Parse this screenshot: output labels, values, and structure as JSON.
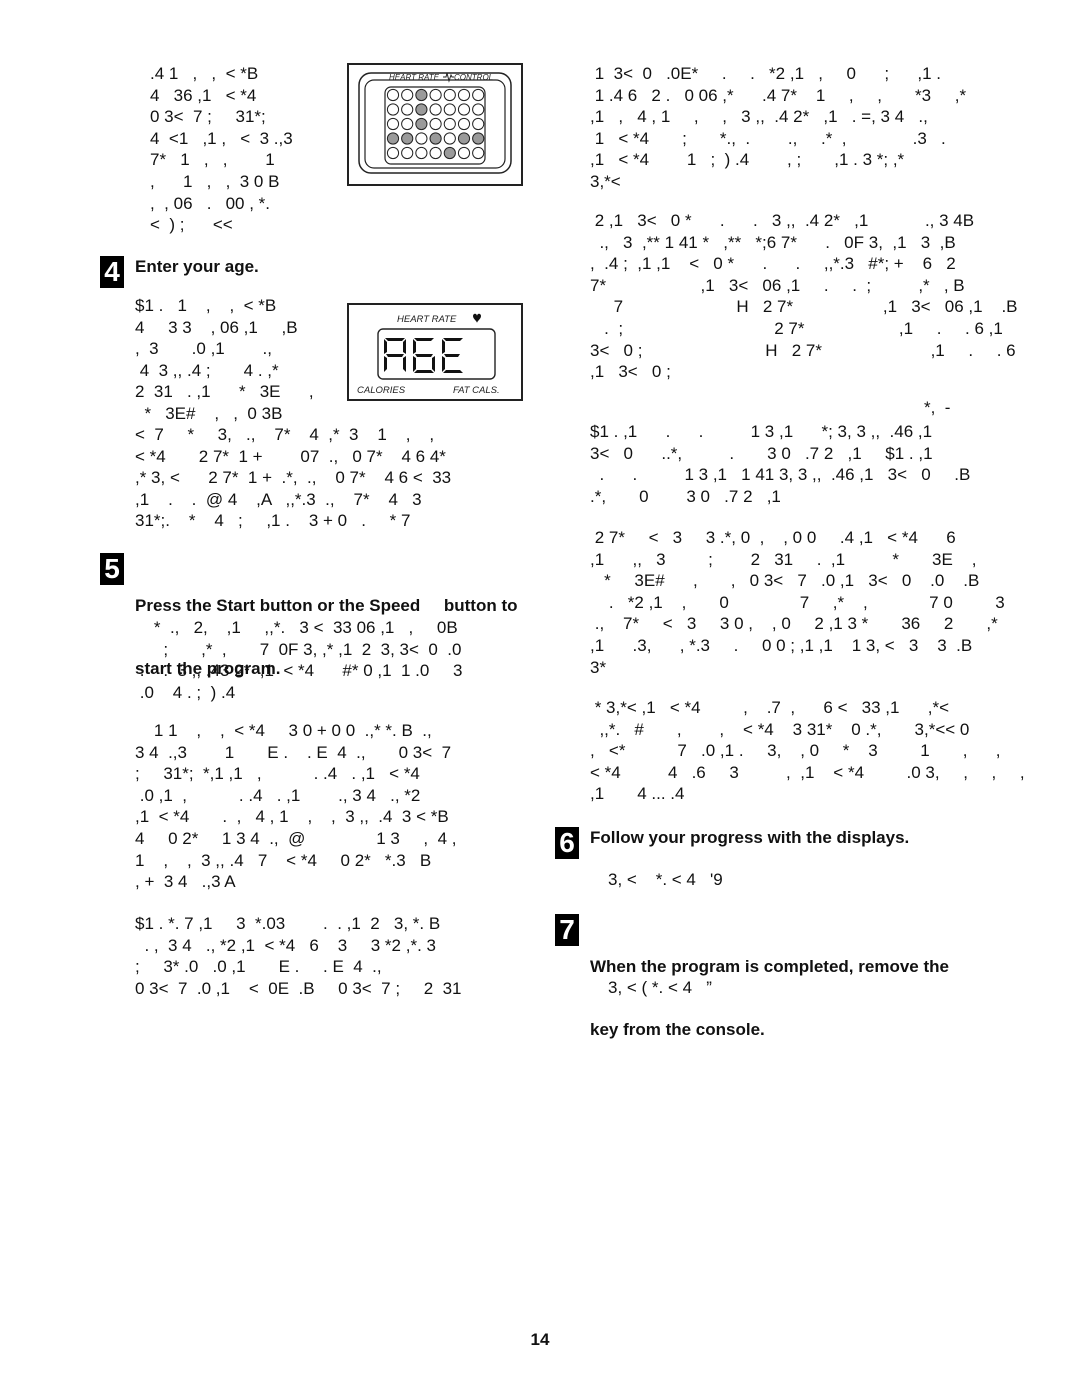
{
  "page": {
    "number": "14"
  },
  "left_column": {
    "intro_lines": [
      ".4 1   ,   ,  < *B",
      "4   36 ,1   < *4",
      "0 3<  7 ;     31*;",
      "4  <1   ,1 ,   <  3 .,3",
      "7*   1   ,   ,        1",
      ",      1   ,   ,  3 0 B",
      ",  , 06   .   00 , *.",
      "<  ) ;      <<"
    ],
    "step4": {
      "number": "4",
      "title": "Enter your age.",
      "lines_beside_figure": [
        "$1 .   1    ,    ,  < *B",
        "4     3 3    , 06 ,1     ,B",
        ",  3       .0 ,1        .,",
        " 4  3 ,, .4 ;       4 . ,*",
        "2  31   . ,1      *   3E      ,",
        "  *   3E#    ,   ,  0 3B"
      ],
      "lines_full": [
        "<  7     *     3,   .,    7*    4  ,*  3    1    ,    ,",
        "< *4       2 7*  1 +        07  .,   0 7*    4 6 4*",
        ",* 3, <      2 7*  1 +  .*,  .,    0 7*    4 6 <  33",
        ",1    .    .  @ 4    ,A   ,,*.3  .,    7*    4   3",
        "31*;.    *    4   ;     ,1 .    3 + 0   .     * 7"
      ]
    },
    "step5": {
      "number": "5",
      "title_lines": [
        "Press the Start button or the Speed     button to",
        "start the program."
      ],
      "para1": [
        "    *  .,   2,    ,1     ,,*.   3 <  33 06 ,1   ,     0B",
        "      ;       ,*  ,       7  0F 3, ,* ,1  2  3, 3<  0  .0",
        " .    .  3 ,, .43 2*  ,1  < *4      #* 0 ,1  1 .0     3",
        " .0    4 . ;  ) .4"
      ],
      "para2": [
        "    1 1    ,    ,  < *4     3 0 + 0 0  .,* *. B  .,",
        "3 4  .,3        1       E .    . E  4  .,       0 3<  7",
        ";     31*;  *,1 ,1   ,           . .4   . ,1   < *4",
        " .0 ,1  ,           . .4   . ,1        ., 3 4   ., *2",
        ",1  < *4       .  ,   4 , 1    ,    ,  3 ,,  .4  3 < *B",
        "4     0 2*     1 3 4  .,  @               1 3     ,  4 ,",
        "1    ,    ,  3 ,, .4   7    < *4     0 2*   *.3   B",
        ", +  3 4   .,3 A"
      ],
      "para3": [
        "$1 . *. 7 ,1     3  *.03        .  . ,1  2   3, *. B",
        "  . ,  3 4   ., *2 ,1  < *4   6    3     3 *2 ,*. 3",
        ";     3* .0   .0 ,1       E .     . E  4  .,",
        "0 3<  7  .0 ,1    <  0E  .B     0 3<  7 ;     2  31"
      ]
    }
  },
  "right_column": {
    "para1": [
      " 1  3<  0   .0E*     .     .   *2 ,1   ,     0      ;      ,1 .",
      " 1 .4 6   2 .   0 06 ,*      .4 7*    1     ,     ,       *3     ,*",
      ",1   ,   4 , 1     ,     ,   3 ,,  .4 2*   ,1   . =, 3 4   .,",
      " 1   < *4       ;       *.,  .        .,     .*  ,              .3   .",
      ",1   < *4        1   ;  ) .4        , ;       ,1 . 3 *; ,*",
      "3,*<"
    ],
    "para2": [
      " 2 ,1   3<   0 *      .      .   3 ,,  .4 2*   ,1            ., 3 4B",
      "  .,   3  ,** 1 41 *   ,**   *;6 7*      .   0F 3,  ,1   3  ,B",
      ",  .4 ;  ,1 ,1    <   0 *      .      .     ,,*.3   #*; +    6   2",
      "7*                    ,1   3<   06 ,1     .     .  ;          ,*   , B",
      "     7                        H   2 7*                   ,1   3<   06 ,1    .B",
      "   .  ;                                2 7*                    ,1     .     . 6 ,1",
      "3<   0 ;                          H   2 7*                       ,1     .     . 6",
      ",1   3<   0 ;"
    ],
    "para3_marker": "*,  -",
    "para3": [
      "$1 . ,1      .      .          1 3 ,1      *; 3, 3 ,,  .46 ,1",
      "3<   0      ..*,          .       3 0   .7 2   ,1     $1 . ,1",
      "  .      .          1 3 ,1   1 41 3, 3 ,,  .46 ,1   3<   0     .B",
      ".*,       0        3 0   .7 2   ,1"
    ],
    "para4": [
      " 2 7*     <   3     3 .*, 0  ,    , 0 0     .4 ,1   < *4      6",
      ",1      ,,   3         ;        2   31     .  ,1          *       3E    ,",
      "   *     3E#      ,       ,   0 3<   7   .0 ,1   3<   0    .0    .B",
      "    .   *2 ,1    ,       0               7     ,*    ,             7 0         3",
      " .,    7*     <   3     3 0 ,    , 0     2 ,1 3 *       36     2       ,*",
      ",1      .3,      , *.3     .     0 0 ; ,1 ,1    1 3, <   3    3  .B",
      "3*"
    ],
    "para5": [
      " * 3,*< ,1   < *4         ,    .7  ,      6 <   33 ,1      ,*<",
      "  ,,*.   #       ,        ,    < *4    3 31*    0 .*,       3,*<< 0",
      ",   <*           7   .0 ,1 .     3,    , 0     *    3         1       ,      ,",
      "< *4          4   .6     3          ,  ,1    < *4         .0 3,     ,     ,     ,",
      ",1       4 ... .4"
    ],
    "step6": {
      "number": "6",
      "title": "Follow your progress with the displays.",
      "body": "3, <    *. < 4   '9"
    },
    "step7": {
      "number": "7",
      "title_lines": [
        "When the program is completed, remove the",
        "key from the console."
      ],
      "body": "3, < ( *. < 4   ”"
    }
  },
  "figures": {
    "heart_rate_control": {
      "label": "HEART RATE",
      "label2": "CONTROL",
      "grid_rows": 5,
      "grid_cols": 7,
      "lit_cells": [
        [
          0,
          2
        ],
        [
          1,
          2
        ],
        [
          2,
          2
        ],
        [
          3,
          0
        ],
        [
          3,
          1
        ],
        [
          3,
          3
        ],
        [
          3,
          5
        ],
        [
          3,
          6
        ],
        [
          4,
          4
        ]
      ],
      "lit_color": "#9a9a9a"
    },
    "age_display": {
      "top_label": "HEART RATE",
      "heart_icon": "heart-icon",
      "lcd_text": "AGE",
      "bottom_left_label": "CALORIES",
      "bottom_right_label": "FAT CALS."
    }
  }
}
